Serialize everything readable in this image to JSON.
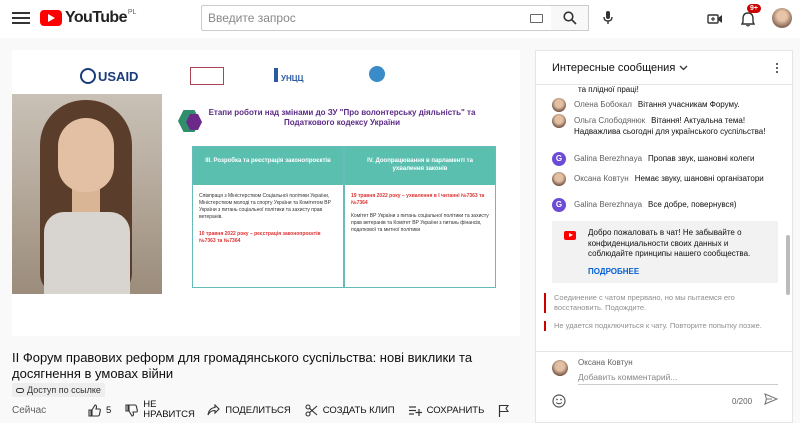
{
  "header": {
    "logo_text": "YouTube",
    "country_code": "PL",
    "search_placeholder": "Введите запрос",
    "notifications_count": "9+"
  },
  "video": {
    "slide": {
      "logo_usaid": "USAID",
      "logo3": "УНЦЦ",
      "title": "Етапи роботи над змінами до ЗУ \"Про волонтерську діяльність\" та Податкового кодексу України",
      "col1_head": "ІІІ. Розробка та реєстрація законопроєктів",
      "col1_body": "Співпраця з Міністерством Соціальної політики України, Міністерством молоді та спорту України та Комітетом ВР України з питань соціальної політики та захисту прав ветеранів.",
      "col1_red": "10 травня 2022 року – реєстрація законопроєктів №7363 та №7364",
      "col2_head": "IV. Доопрацювання в парламенті та ухвалення законів",
      "col2_red": "19 травня 2022 року – ухвалення в І читанні №7363 та №7364",
      "col2_body": "Комітет ВР України з питань соціальної політики та захисту прав ветеранів та Комітет ВР України з питань фінансів, податкової та митної політики"
    },
    "title": "ІІ Форум правових реформ для громадянського суспільства: нові виклики та досягнення в умовах війни",
    "visibility_badge": "Доступ по ссылке",
    "date": "Сейчас"
  },
  "actions": {
    "likes": "5",
    "dislike_label": "НЕ НРАВИТСЯ",
    "share_label": "ПОДЕЛИТЬСЯ",
    "clip_label": "СОЗДАТЬ КЛИП",
    "save_label": "СОХРАНИТЬ"
  },
  "chat": {
    "header": "Интересные сообщения",
    "messages": [
      {
        "name": "",
        "text": "та плідної праці!"
      },
      {
        "name": "Олена Бобокал",
        "text": "Вітання учасникам Форуму."
      },
      {
        "name": "Ольга Слободянюк",
        "text": "Вітання! Актуальна тема! Надважлива сьогодні для українського суспільства!"
      },
      {
        "name": "Galina Berezhnaya",
        "text": "Пропав звук, шановні колеги",
        "initial": "G"
      },
      {
        "name": "Оксана Ковтун",
        "text": "Немає звуку, шановні організатори"
      },
      {
        "name": "Galina Berezhnaya",
        "text": "Все добре, повернувся)",
        "initial": "G"
      }
    ],
    "welcome_text": "Добро пожаловать в чат! Не забывайте о конфиденциальности своих данных и соблюдайте принципы нашего сообщества.",
    "welcome_link": "ПОДРОБНЕЕ",
    "system_messages": [
      "Соединение с чатом прервано, но мы пытаемся его восстановить. Подождите.",
      "Не удается подключиться к чату. Повторите попытку позже."
    ],
    "composer": {
      "user_name": "Оксана Ковтун",
      "placeholder": "Добавить комментарий...",
      "counter": "0/200"
    }
  }
}
